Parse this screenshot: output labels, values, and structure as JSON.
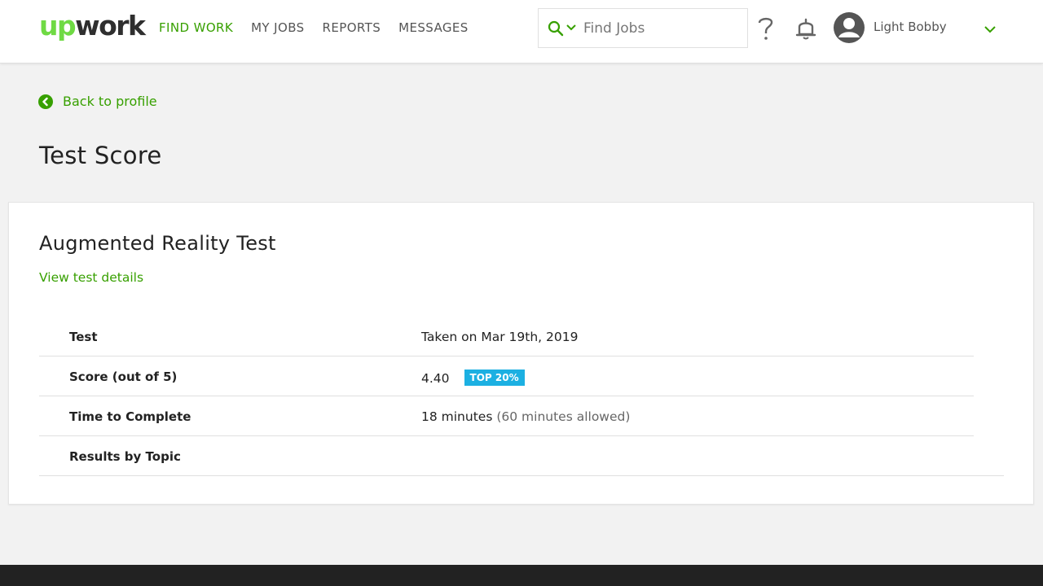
{
  "header": {
    "logo_up": "up",
    "logo_work": "work",
    "nav": [
      {
        "label": "FIND WORK",
        "active": true
      },
      {
        "label": "MY JOBS",
        "active": false
      },
      {
        "label": "REPORTS",
        "active": false
      },
      {
        "label": "MESSAGES",
        "active": false
      }
    ],
    "search_placeholder": "Find Jobs",
    "user_name": "Light Bobby"
  },
  "back_link": "Back to profile",
  "page_title": "Test Score",
  "card": {
    "title": "Augmented Reality Test",
    "details_link": "View test details",
    "rows": [
      {
        "label": "Test",
        "value": "Taken on Mar 19th, 2019"
      },
      {
        "label": "Score (out of 5)",
        "value": "4.40",
        "badge": "TOP 20%"
      },
      {
        "label": "Time to Complete",
        "value": "18 minutes",
        "value_note": "(60 minutes allowed)"
      },
      {
        "label": "Results by Topic",
        "value": ""
      }
    ]
  },
  "colors": {
    "brand_green": "#6fda44",
    "link_green": "#37a000",
    "badge_blue": "#1cb0e2"
  },
  "icons": [
    "search-icon",
    "chevron-down-icon",
    "help-icon",
    "bell-icon",
    "avatar-icon",
    "back-arrow-icon"
  ]
}
